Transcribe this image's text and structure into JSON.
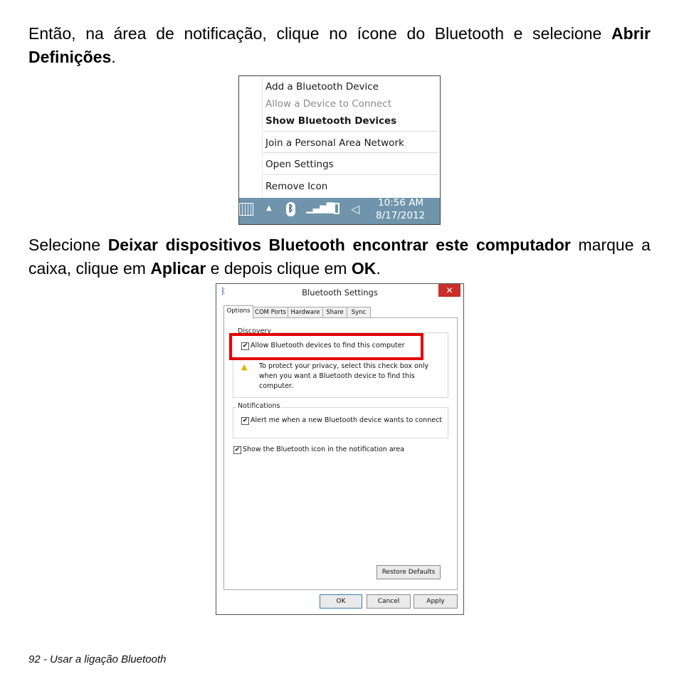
{
  "paragraph1": {
    "text": "Então, na área de notificação, clique no ícone do Bluetooth e selecione ",
    "bold": "Abrir Definições",
    "end": "."
  },
  "menu": {
    "items": [
      {
        "label": "Add a Bluetooth Device"
      },
      {
        "label": "Allow a Device to Connect"
      },
      {
        "label": "Show Bluetooth Devices"
      },
      {
        "label": "Join a Personal Area Network"
      },
      {
        "label": "Open Settings"
      },
      {
        "label": "Remove Icon"
      }
    ],
    "taskbar": {
      "time": "10:56 AM",
      "date": "8/17/2012",
      "icons": [
        "keyboard-icon",
        "chevron-up-icon",
        "bluetooth-icon",
        "network-icon",
        "battery-icon",
        "speaker-icon"
      ]
    }
  },
  "paragraph2": {
    "t1": "Selecione ",
    "b1": "Deixar dispositivos Bluetooth encontrar este computador",
    "t2": " marque a caixa, clique em ",
    "b2": "Aplicar",
    "t3": " e depois clique em ",
    "b3": "OK",
    "t4": "."
  },
  "dialog": {
    "title": "Bluetooth Settings",
    "close_glyph": "✕",
    "tabs": [
      "Options",
      "COM Ports",
      "Hardware",
      "Share",
      "Sync"
    ],
    "discovery": {
      "label": "Discovery",
      "allow_label": "Allow Bluetooth devices to find this computer",
      "allow_checked": true,
      "note": "To protect your privacy, select this check box only when you want a Bluetooth device to find this computer."
    },
    "notifications": {
      "label": "Notifications",
      "alert_label": "Alert me when a new Bluetooth device wants to connect",
      "alert_checked": true
    },
    "show_icon_label": "Show the Bluetooth icon in the notification area",
    "show_icon_checked": true,
    "restore_label": "Restore Defaults",
    "ok_label": "OK",
    "cancel_label": "Cancel",
    "apply_label": "Apply",
    "check_glyph": "✔",
    "highlight_color": "#e40000"
  },
  "footer": "92 - Usar a ligação Bluetooth"
}
